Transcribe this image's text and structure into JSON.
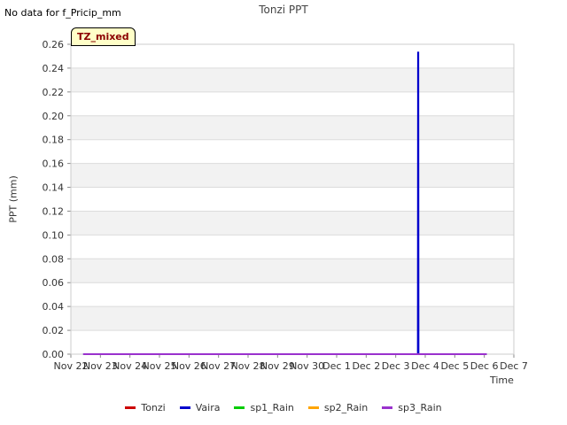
{
  "header": {
    "nodata_text": "No data for f_Pricip_mm",
    "tag_label": "TZ_mixed"
  },
  "chart_data": {
    "type": "line",
    "title": "Tonzi PPT",
    "xlabel": "Time",
    "ylabel": "PPT (mm)",
    "ylim": [
      0,
      0.26
    ],
    "y_ticks": [
      "0.00",
      "0.02",
      "0.04",
      "0.06",
      "0.08",
      "0.10",
      "0.12",
      "0.14",
      "0.16",
      "0.18",
      "0.20",
      "0.22",
      "0.24",
      "0.26"
    ],
    "x_ticks": [
      "Nov 22",
      "Nov 23",
      "Nov 24",
      "Nov 25",
      "Nov 26",
      "Nov 27",
      "Nov 28",
      "Nov 29",
      "Nov 30",
      "Dec 1",
      "Dec 2",
      "Dec 3",
      "Dec 4",
      "Dec 5",
      "Dec 6",
      "Dec 7"
    ],
    "xlim": [
      "2023-11-22",
      "2023-12-07"
    ],
    "grid": true,
    "legend_position": "bottom",
    "series": [
      {
        "name": "Tonzi",
        "color": "#cc0000",
        "x": [],
        "y": []
      },
      {
        "name": "Vaira",
        "color": "#0000cc",
        "x": [
          "2023-11-22 10:00",
          "2023-12-03 18:00",
          "2023-12-03 18:10",
          "2023-12-03 18:20",
          "2023-12-03 18:30",
          "2023-12-06 02:00"
        ],
        "y": [
          0,
          0,
          0.253,
          0.253,
          0,
          0
        ]
      },
      {
        "name": "sp1_Rain",
        "color": "#00cc00",
        "x": [],
        "y": []
      },
      {
        "name": "sp2_Rain",
        "color": "#ffa500",
        "x": [],
        "y": []
      },
      {
        "name": "sp3_Rain",
        "color": "#9a32cd",
        "x": [
          "2023-11-22 10:00",
          "2023-12-06 02:00"
        ],
        "y": [
          0,
          0
        ]
      }
    ]
  }
}
